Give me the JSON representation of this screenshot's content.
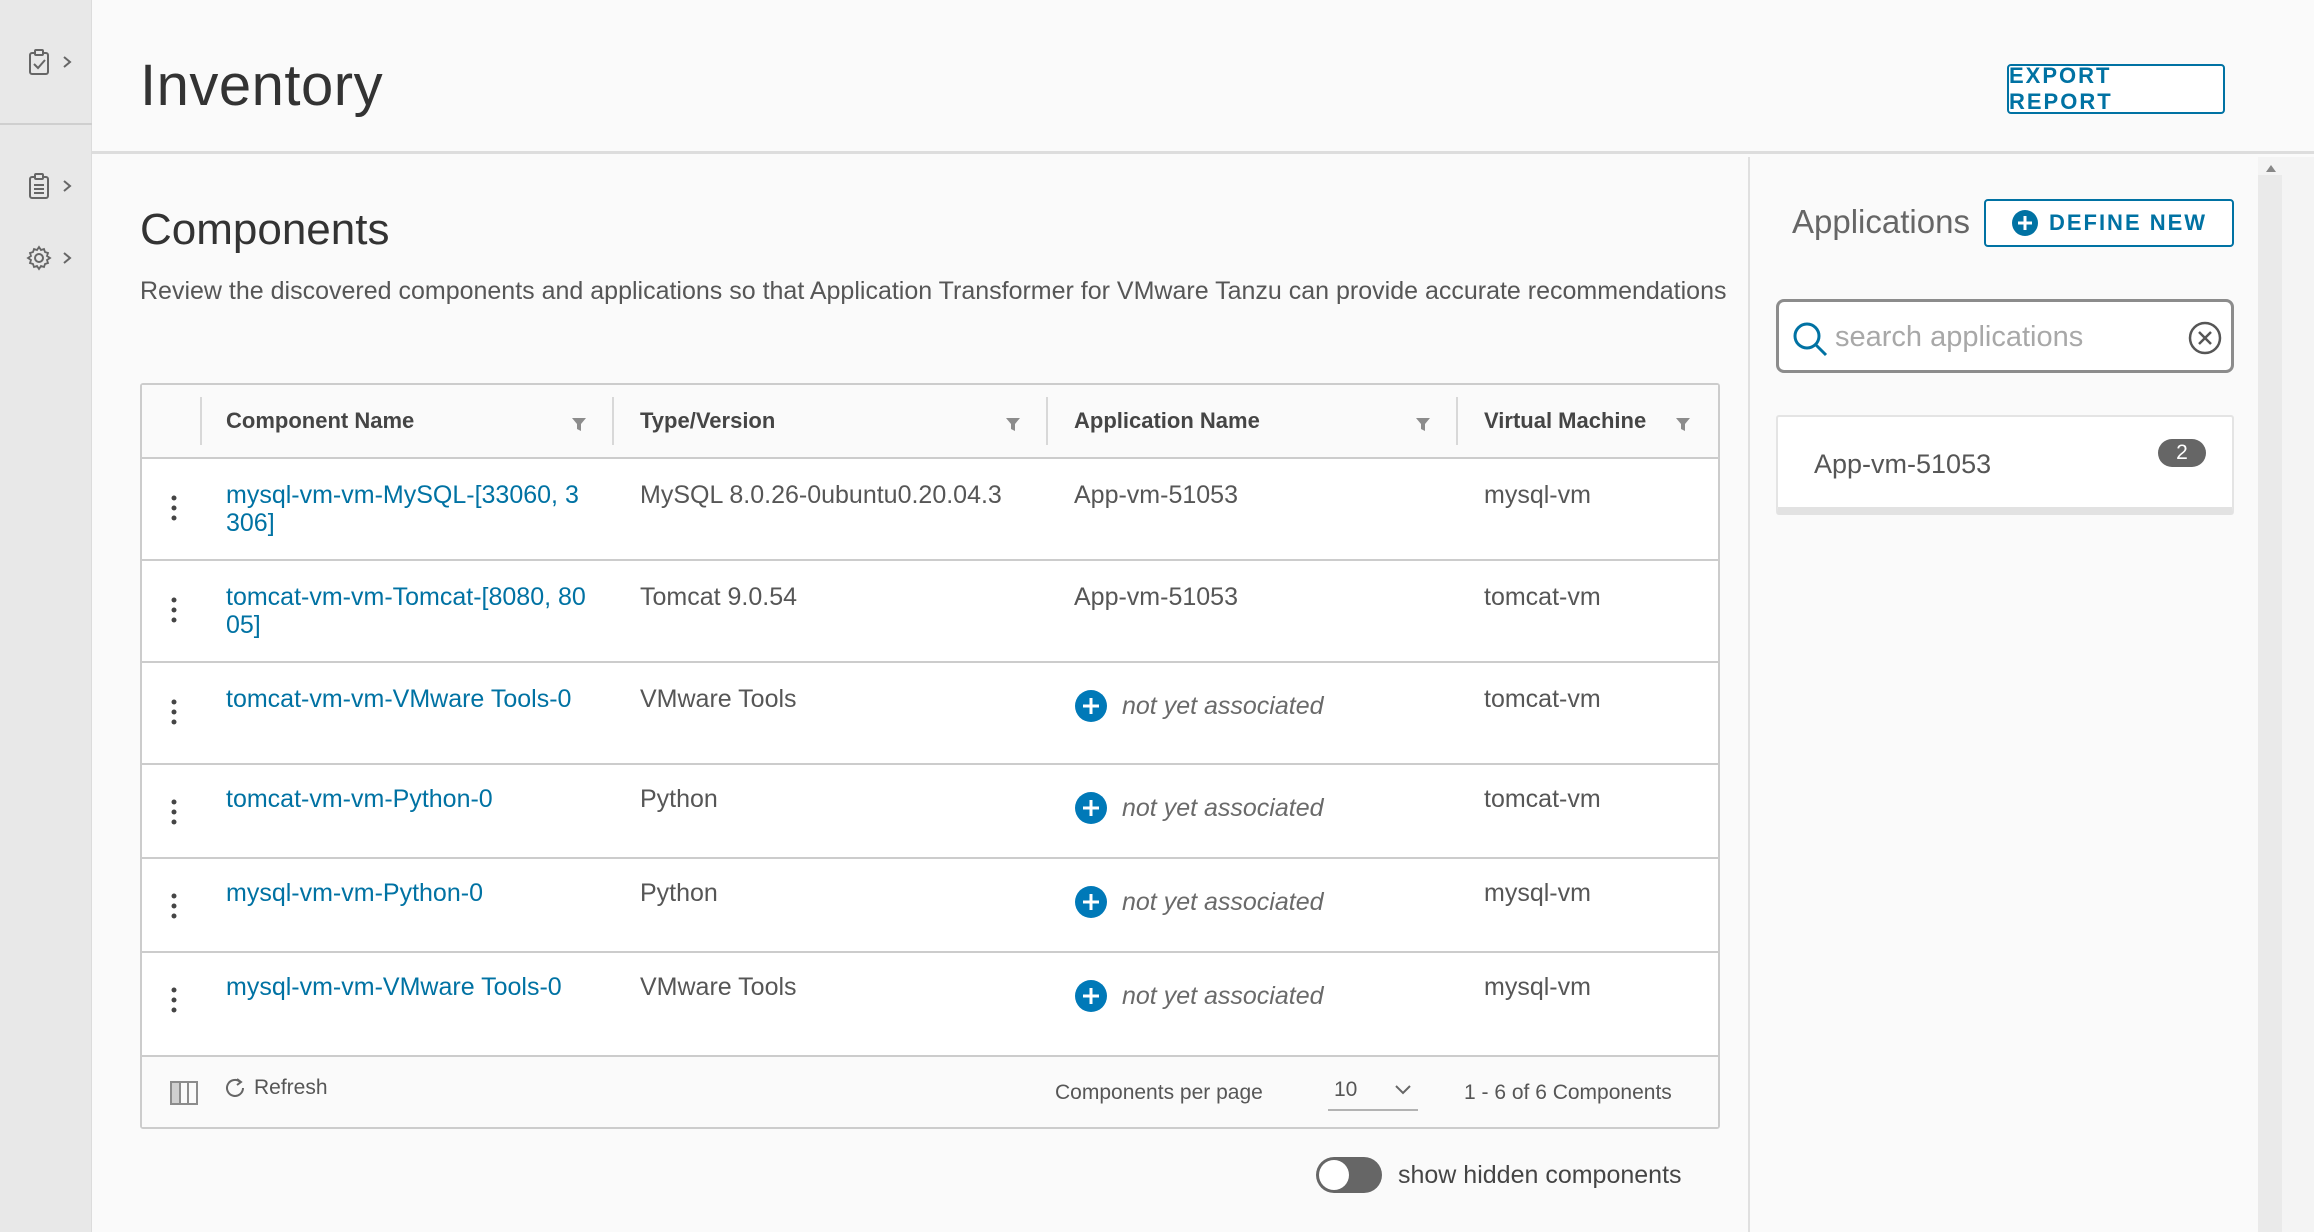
{
  "header": {
    "title": "Inventory",
    "export_label": "EXPORT REPORT"
  },
  "main": {
    "title": "Components",
    "description": "Review the discovered components and applications so that Application Transformer for VMware Tanzu can provide accurate recommendations"
  },
  "table": {
    "columns": [
      "Component Name",
      "Type/Version",
      "Application Name",
      "Virtual Machine"
    ],
    "rows": [
      {
        "component": "mysql-vm-vm-MySQL-[33060, 3306]",
        "type": "MySQL 8.0.26-0ubuntu0.20.04.3",
        "application": "App-vm-51053",
        "vm": "mysql-vm"
      },
      {
        "component": "tomcat-vm-vm-Tomcat-[8080, 8005]",
        "type": "Tomcat 9.0.54",
        "application": "App-vm-51053",
        "vm": "tomcat-vm"
      },
      {
        "component": "tomcat-vm-vm-VMware Tools-0",
        "type": "VMware Tools",
        "application": "not yet associated",
        "vm": "tomcat-vm"
      },
      {
        "component": "tomcat-vm-vm-Python-0",
        "type": "Python",
        "application": "not yet associated",
        "vm": "tomcat-vm"
      },
      {
        "component": "mysql-vm-vm-Python-0",
        "type": "Python",
        "application": "not yet associated",
        "vm": "mysql-vm"
      },
      {
        "component": "mysql-vm-vm-VMware Tools-0",
        "type": "VMware Tools",
        "application": "not yet associated",
        "vm": "mysql-vm"
      }
    ],
    "footer": {
      "refresh_label": "Refresh",
      "per_page_label": "Components per page",
      "per_page_value": "10",
      "paging_info": "1 - 6 of 6 Components"
    }
  },
  "toggle": {
    "label": "show hidden components",
    "on": false
  },
  "side": {
    "title": "Applications",
    "define_label": "DEFINE NEW",
    "search_placeholder": "search applications",
    "apps": [
      {
        "name": "App-vm-51053",
        "count": "2"
      }
    ]
  },
  "colors": {
    "accent": "#0072a3",
    "plus": "#0079b8"
  },
  "icons": [
    "clipboard-check-icon",
    "clipboard-list-icon",
    "gear-icon",
    "chevron-right-icon",
    "filter-icon",
    "kebab-icon",
    "plus-circle-icon",
    "column-toggle-icon",
    "refresh-icon",
    "chevron-down-icon",
    "search-icon",
    "clear-circle-icon"
  ]
}
